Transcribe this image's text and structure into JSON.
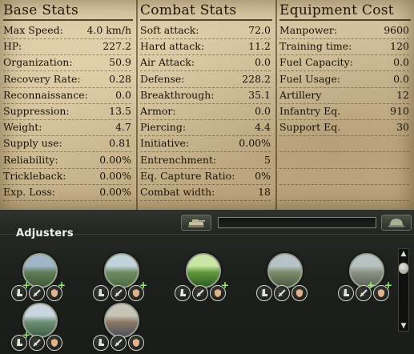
{
  "base_stats": {
    "title": "Base Stats",
    "rows": [
      {
        "label": "Max Speed:",
        "value": "4.0 km/h"
      },
      {
        "label": "HP:",
        "value": "227.2"
      },
      {
        "label": "Organization:",
        "value": "50.9"
      },
      {
        "label": "Recovery Rate:",
        "value": "0.28"
      },
      {
        "label": "Reconnaissance:",
        "value": "0.0"
      },
      {
        "label": "Suppression:",
        "value": "13.5"
      },
      {
        "label": "Weight:",
        "value": "4.7"
      },
      {
        "label": "Supply use:",
        "value": "0.81"
      },
      {
        "label": "Reliability:",
        "value": "0.00%"
      },
      {
        "label": "Trickleback:",
        "value": "0.00%"
      },
      {
        "label": "Exp. Loss:",
        "value": "0.00%"
      }
    ]
  },
  "combat_stats": {
    "title": "Combat Stats",
    "rows": [
      {
        "label": "Soft attack:",
        "value": "72.0"
      },
      {
        "label": "Hard attack:",
        "value": "11.2"
      },
      {
        "label": "Air Attack:",
        "value": "0.0"
      },
      {
        "label": "Defense:",
        "value": "228.2"
      },
      {
        "label": "Breakthrough:",
        "value": "35.1"
      },
      {
        "label": "Armor:",
        "value": "0.0"
      },
      {
        "label": "Piercing:",
        "value": "4.4"
      },
      {
        "label": "Initiative:",
        "value": "0.00%"
      },
      {
        "label": "Entrenchment:",
        "value": "5"
      },
      {
        "label": "Eq. Capture Ratio:",
        "value": "0%"
      },
      {
        "label": "Combat width:",
        "value": "18"
      }
    ]
  },
  "equipment_cost": {
    "title": "Equipment Cost",
    "rows": [
      {
        "label": "Manpower:",
        "value": "9600"
      },
      {
        "label": "Training time:",
        "value": "120"
      },
      {
        "label": "Fuel Capacity:",
        "value": "0.0"
      },
      {
        "label": "Fuel Usage:",
        "value": "0.0"
      },
      {
        "label": "Artillery",
        "value": "12"
      },
      {
        "label": "Infantry Eq.",
        "value": "910"
      },
      {
        "label": "Support Eq.",
        "value": "30"
      },
      {
        "label": "",
        "value": ""
      },
      {
        "label": "",
        "value": ""
      },
      {
        "label": "",
        "value": ""
      },
      {
        "label": "",
        "value": ""
      }
    ]
  },
  "toolbar": {
    "left_tab_icon": "tank-icon",
    "right_tab_icon": "helmet-icon",
    "progress_fraction": 0.0
  },
  "adjusters": {
    "title": "Adjusters",
    "items": [
      {
        "terrain": "plains",
        "colors": [
          "#9fb7c9",
          "#5f7d56",
          "#3f5a38"
        ],
        "badges": [
          "+",
          "",
          "+"
        ]
      },
      {
        "terrain": "hills",
        "colors": [
          "#c3d3dc",
          "#6f8c62",
          "#4b6a43"
        ],
        "badges": [
          "",
          "",
          "+"
        ]
      },
      {
        "terrain": "forest",
        "colors": [
          "#c9e6a4",
          "#5f9a3c",
          "#2f5a24"
        ],
        "badges": [
          "",
          "",
          "+"
        ]
      },
      {
        "terrain": "marsh",
        "colors": [
          "#b6c4c9",
          "#7c8c6a",
          "#4b5c46"
        ],
        "badges": [
          "",
          "",
          ""
        ]
      },
      {
        "terrain": "mountain",
        "colors": [
          "#b9c2c3",
          "#8a9282",
          "#5c6157"
        ],
        "badges": [
          "",
          "+",
          "+"
        ]
      },
      {
        "terrain": "river",
        "colors": [
          "#c9d6df",
          "#6f8f74",
          "#3c5c49"
        ],
        "badges": [
          "+",
          "",
          ""
        ]
      },
      {
        "terrain": "urban",
        "colors": [
          "#c8c4b8",
          "#8c7a64",
          "#4a5060"
        ],
        "badges": [
          "",
          "",
          ""
        ]
      }
    ]
  }
}
